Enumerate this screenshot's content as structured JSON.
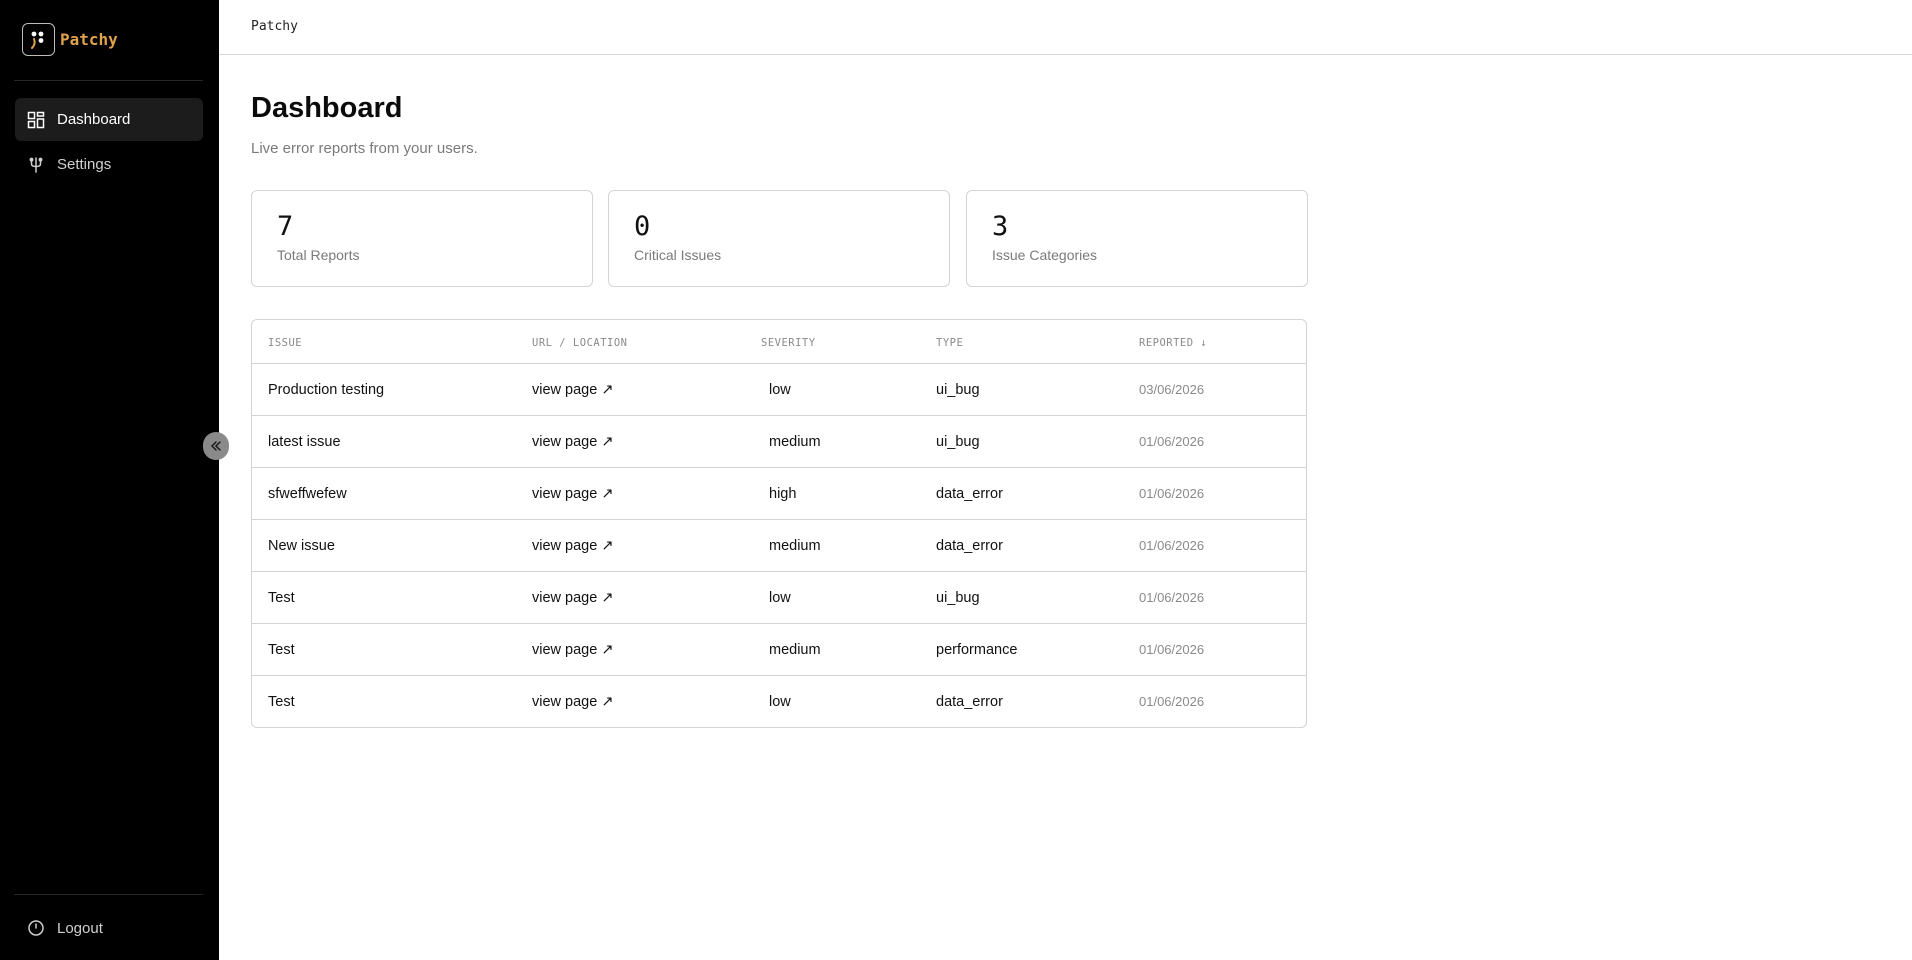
{
  "app": {
    "name": "Patchy",
    "topbar_title": "Patchy"
  },
  "sidebar": {
    "items": [
      {
        "label": "Dashboard",
        "icon": "grid-icon",
        "active": true
      },
      {
        "label": "Settings",
        "icon": "fork-icon",
        "active": false
      }
    ],
    "logout_label": "Logout"
  },
  "page": {
    "title": "Dashboard",
    "subtitle": "Live error reports from your users."
  },
  "stats": [
    {
      "value": "7",
      "label": "Total Reports"
    },
    {
      "value": "0",
      "label": "Critical Issues"
    },
    {
      "value": "3",
      "label": "Issue Categories"
    }
  ],
  "table": {
    "columns": [
      "ISSUE",
      "URL / LOCATION",
      "SEVERITY",
      "TYPE",
      "REPORTED ↓"
    ],
    "rows": [
      {
        "issue": "Production testing",
        "link": "view page ↗",
        "severity": "low",
        "type": "ui_bug",
        "reported": "03/06/2026"
      },
      {
        "issue": "latest issue",
        "link": "view page ↗",
        "severity": "medium",
        "type": "ui_bug",
        "reported": "01/06/2026"
      },
      {
        "issue": "sfweffwefew",
        "link": "view page ↗",
        "severity": "high",
        "type": "data_error",
        "reported": "01/06/2026"
      },
      {
        "issue": "New issue",
        "link": "view page ↗",
        "severity": "medium",
        "type": "data_error",
        "reported": "01/06/2026"
      },
      {
        "issue": "Test",
        "link": "view page ↗",
        "severity": "low",
        "type": "ui_bug",
        "reported": "01/06/2026"
      },
      {
        "issue": "Test",
        "link": "view page ↗",
        "severity": "medium",
        "type": "performance",
        "reported": "01/06/2026"
      },
      {
        "issue": "Test",
        "link": "view page ↗",
        "severity": "low",
        "type": "data_error",
        "reported": "01/06/2026"
      }
    ]
  },
  "colors": {
    "brand": "#e0a24c",
    "sidebar_bg": "#000000",
    "active_item_bg": "#1c1c1c"
  }
}
